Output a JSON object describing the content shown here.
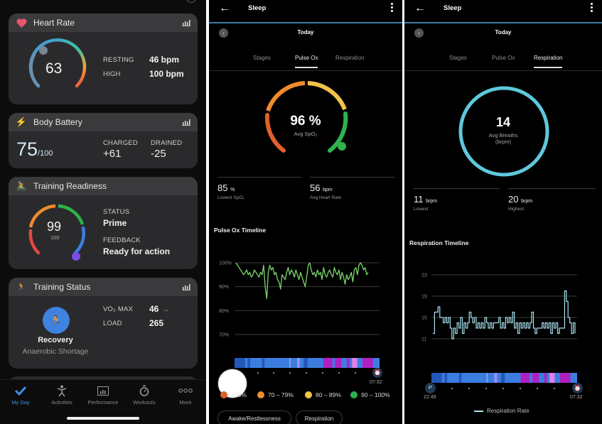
{
  "my_day": {
    "heart_rate": {
      "title": "Heart Rate",
      "current": "63",
      "resting_label": "RESTING",
      "resting_value": "46 bpm",
      "high_label": "HIGH",
      "high_value": "100 bpm",
      "accent": "#e8566e"
    },
    "body_battery": {
      "title": "Body Battery",
      "value": "75",
      "max": "/100",
      "charged_label": "CHARGED",
      "charged_value": "+61",
      "drained_label": "DRAINED",
      "drained_value": "-25"
    },
    "training_readiness": {
      "title": "Training Readiness",
      "score": "99",
      "max": "100",
      "status_label": "STATUS",
      "status_value": "Prime",
      "feedback_label": "FEEDBACK",
      "feedback_value": "Ready for action",
      "gauge_fraction": 0.99
    },
    "training_status": {
      "title": "Training Status",
      "status": "Recovery",
      "sub": "Anaerobic Shortage",
      "vo2_label": "VO₂ MAX",
      "vo2_value": "46",
      "vo2_trend": "→",
      "load_label": "LOAD",
      "load_value": "265"
    },
    "tabs": [
      {
        "label": "My Day",
        "icon": "check-icon",
        "active": true
      },
      {
        "label": "Activities",
        "icon": "person-icon",
        "active": false
      },
      {
        "label": "Performance",
        "icon": "chart-icon",
        "active": false
      },
      {
        "label": "Workouts",
        "icon": "stopwatch-icon",
        "active": false
      },
      {
        "label": "More",
        "icon": "more-icon",
        "active": false
      }
    ]
  },
  "pulse_ox": {
    "header_title": "Sleep",
    "date": "Today",
    "tabs": [
      "Stages",
      "Pulse Ox",
      "Respiration"
    ],
    "active_tab": "Pulse Ox",
    "avg_value": "96 %",
    "avg_label": "Avg SpO₂",
    "lowest_value": "85",
    "lowest_unit": "%",
    "lowest_label": "Lowest SpO₂",
    "hr_value": "56",
    "hr_unit": "bpm",
    "hr_label": "Avg Heart Rate",
    "timeline_title": "Pulse Ox Timeline",
    "end_time": "07:32",
    "legend": [
      {
        "label": "<70%",
        "color": "#e0602a"
      },
      {
        "label": "70 – 79%",
        "color": "#f08a2e"
      },
      {
        "label": "80 – 89%",
        "color": "#f2c34a"
      },
      {
        "label": "90 – 100%",
        "color": "#2fb24d"
      }
    ],
    "pills": [
      "Awake/Restlessness",
      "Respiration"
    ]
  },
  "respiration": {
    "header_title": "Sleep",
    "date": "Today",
    "tabs": [
      "Stages",
      "Pulse Ox",
      "Respiration"
    ],
    "active_tab": "Respiration",
    "avg_value": "14",
    "avg_label_1": "Avg Breaths",
    "avg_label_2": "(brpm)",
    "lowest_value": "11",
    "lowest_unit": "brpm",
    "lowest_label": "Lowest",
    "highest_value": "20",
    "highest_unit": "brpm",
    "highest_label": "Highest",
    "timeline_title": "Respiration Timeline",
    "start_time": "22:49",
    "end_time": "07:32",
    "legend_label": "Respiration Rate"
  },
  "chart_data": [
    {
      "type": "line",
      "title": "Pulse Ox Timeline",
      "ylabel": "SpO₂",
      "yticks": [
        "100%",
        "90%",
        "80%",
        "70%"
      ],
      "ylim": [
        70,
        100
      ],
      "series": [
        {
          "name": "SpO₂",
          "values": [
            100,
            99,
            98,
            97,
            96,
            95,
            96,
            97,
            95,
            96,
            94,
            95,
            97,
            96,
            95,
            94,
            96,
            95,
            99,
            90,
            85,
            96,
            99,
            97,
            98,
            95,
            96,
            93,
            92,
            89,
            95,
            94,
            93,
            96,
            98,
            95,
            97,
            96,
            94,
            97,
            95,
            93,
            96,
            94,
            92,
            90,
            94,
            99,
            100,
            97,
            95,
            96,
            94,
            97,
            95,
            96,
            93,
            98,
            95,
            94,
            96,
            97,
            95,
            94,
            98,
            96,
            95,
            97,
            93,
            96,
            94,
            91,
            95,
            93,
            94,
            96,
            92,
            97,
            98,
            95,
            99,
            100,
            99,
            97,
            98,
            95,
            96
          ]
        }
      ]
    },
    {
      "type": "line",
      "title": "Respiration Timeline",
      "ylabel": "brpm",
      "yticks": [
        "23",
        "19",
        "15",
        "11"
      ],
      "ylim": [
        11,
        23
      ],
      "x_start": "22:49",
      "x_end": "07:32",
      "series": [
        {
          "name": "Respiration Rate",
          "values": [
            12,
            16,
            16,
            17,
            15,
            15,
            14,
            15,
            14,
            15,
            13,
            11,
            13,
            12,
            14,
            13,
            15,
            12,
            14,
            13,
            14,
            16,
            15,
            14,
            15,
            13,
            14,
            13,
            14,
            13,
            15,
            14,
            13,
            14,
            13,
            14,
            14,
            14,
            15,
            13,
            14,
            13,
            15,
            14,
            15,
            14,
            16,
            13,
            14,
            12,
            14,
            13,
            14,
            13,
            14,
            13,
            14,
            16,
            13,
            12,
            13,
            13,
            13,
            14,
            13,
            14,
            13,
            14,
            12,
            14,
            13,
            14,
            12,
            13,
            13,
            13,
            20,
            18,
            15,
            14,
            12,
            14,
            12
          ]
        }
      ]
    }
  ]
}
